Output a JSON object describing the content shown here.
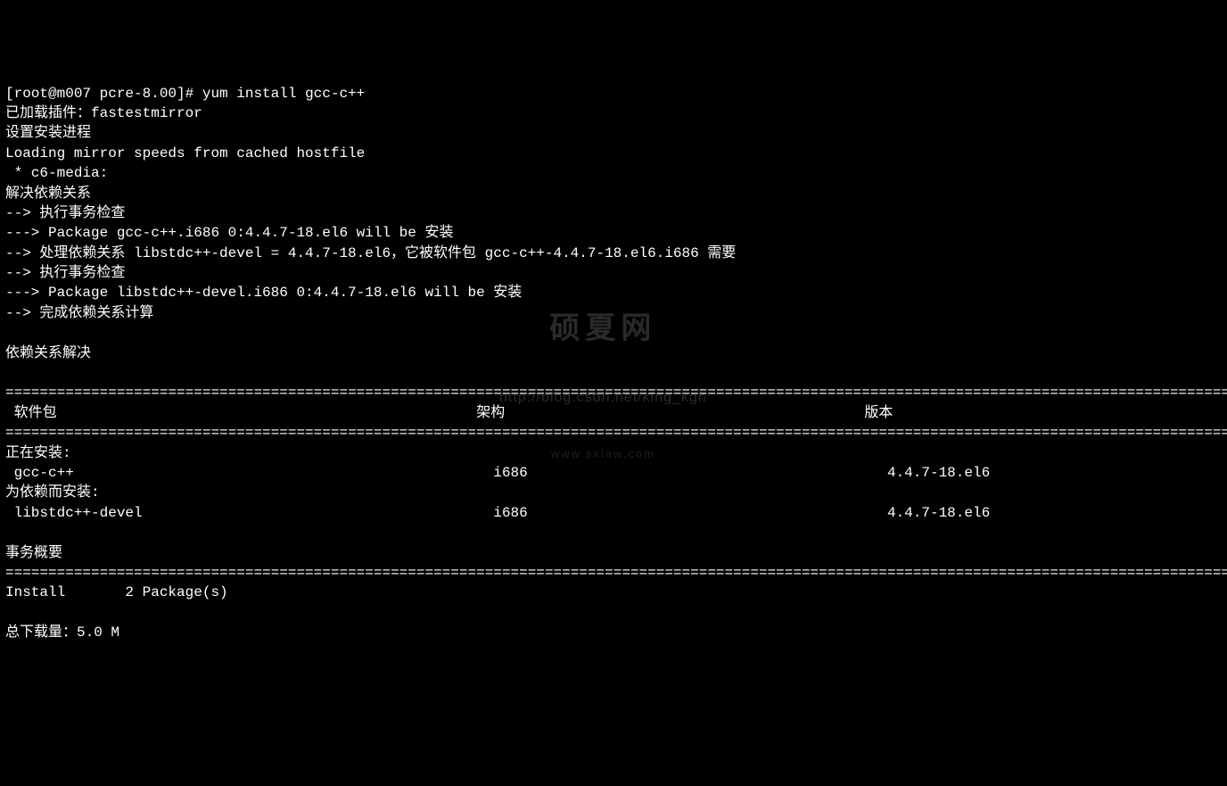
{
  "prompt": {
    "ps1": "[root@m007 pcre-8.00]# ",
    "command": "yum install gcc-c++"
  },
  "lines": {
    "l1": "已加载插件：fastestmirror",
    "l2": "设置安装进程",
    "l3": "Loading mirror speeds from cached hostfile",
    "l4": " * c6-media: ",
    "l5": "解决依赖关系",
    "l6": "--> 执行事务检查",
    "l7": "---> Package gcc-c++.i686 0:4.4.7-18.el6 will be 安装",
    "l8": "--> 处理依赖关系 libstdc++-devel = 4.4.7-18.el6，它被软件包 gcc-c++-4.4.7-18.el6.i686 需要",
    "l9": "--> 执行事务检查",
    "l10": "---> Package libstdc++-devel.i686 0:4.4.7-18.el6 will be 安装",
    "l11": "--> 完成依赖关系计算",
    "blank1": "",
    "l12": "依赖关系解决",
    "blank2": ""
  },
  "separator": "================================================================================================================================================================",
  "header": {
    "col1": " 软件包",
    "col2": "架构",
    "col3": "版本"
  },
  "sections": {
    "installing": "正在安装:",
    "deps": "为依赖而安装:"
  },
  "packages": {
    "p1": {
      "name": " gcc-c++",
      "arch": "i686",
      "version": "4.4.7-18.el6"
    },
    "p2": {
      "name": " libstdc++-devel",
      "arch": "i686",
      "version": "4.4.7-18.el6"
    }
  },
  "summary": {
    "title": "事务概要",
    "install": "Install       2 Package(s)",
    "download": "总下载量：5.0 M"
  },
  "watermark": {
    "main": "硕夏网",
    "sub": "http://blog.csdn.net/king_kgh",
    "sub2": "www.sxlaw.com"
  }
}
